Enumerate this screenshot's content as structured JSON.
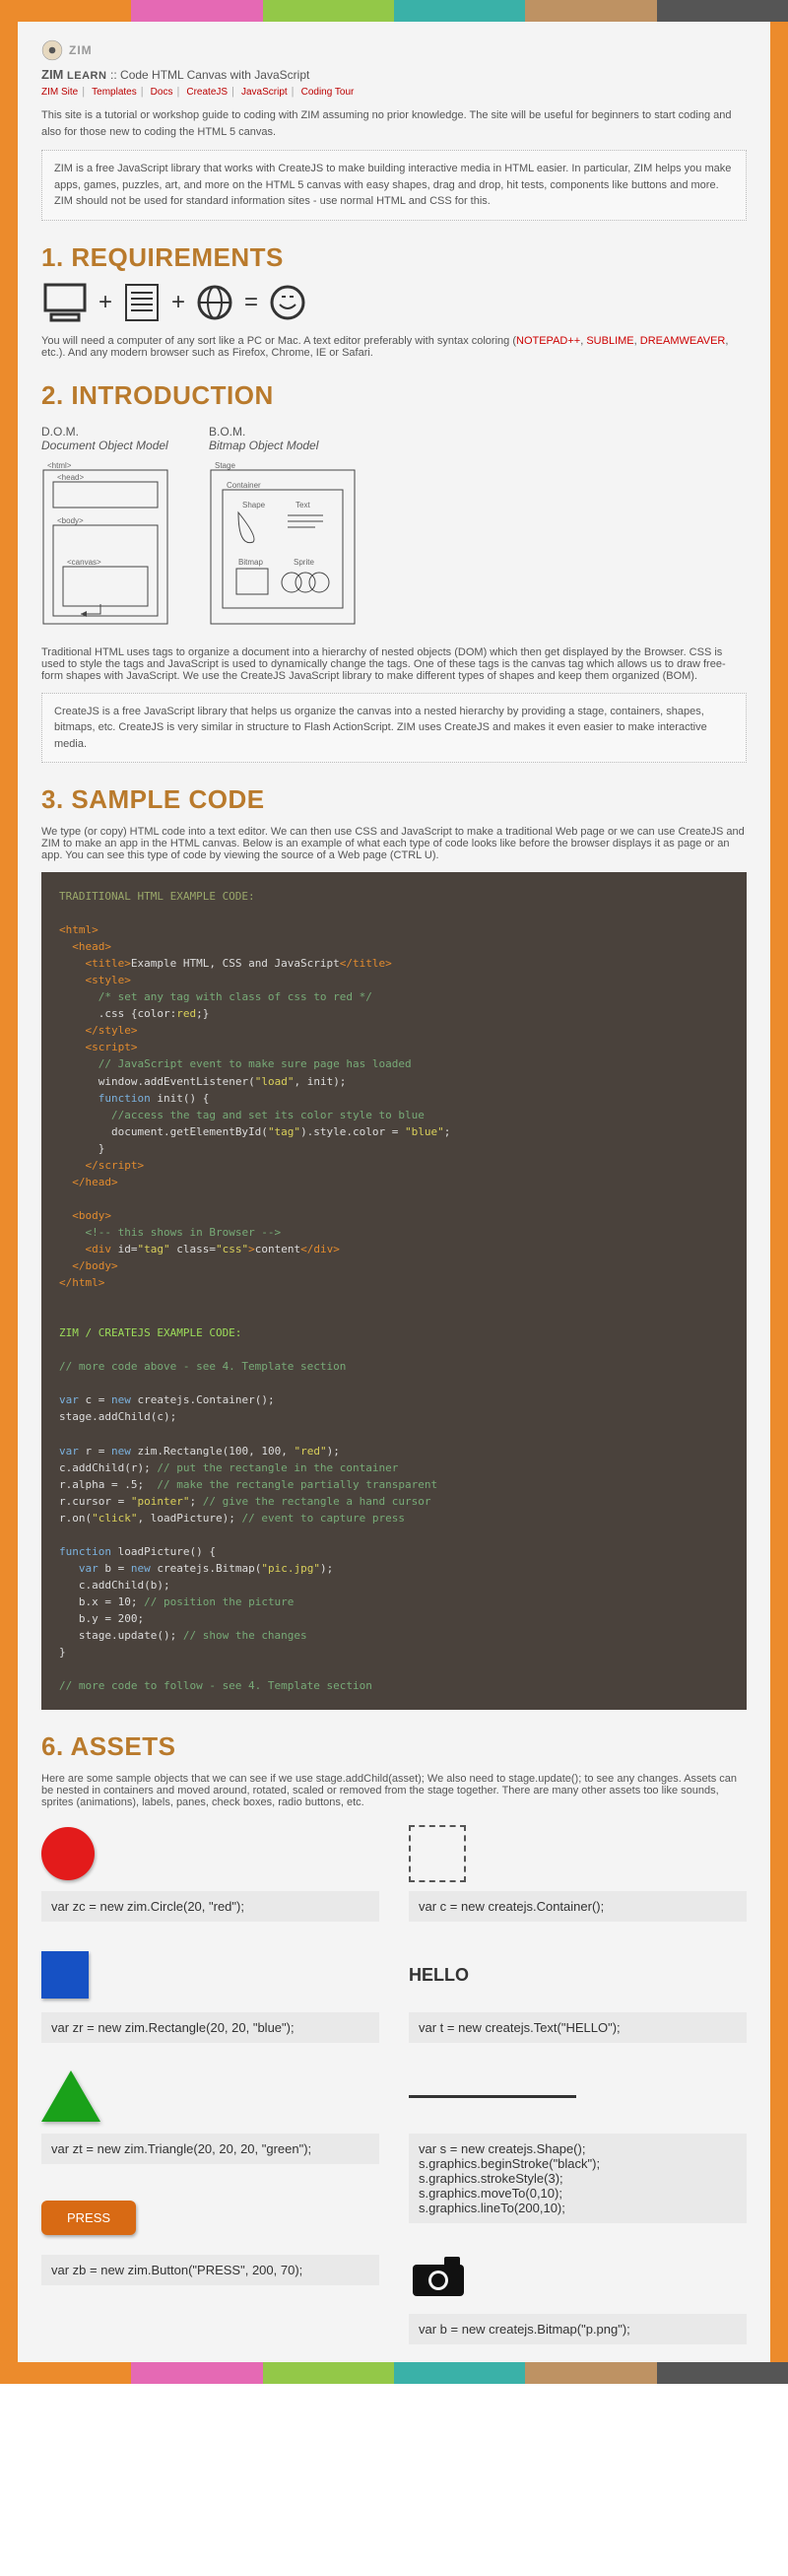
{
  "colors": {
    "s1": "#EC8B2C",
    "s2": "#E569B4",
    "s3": "#93C848",
    "s4": "#3AB1A8",
    "s5": "#BE9263",
    "s6": "#555555"
  },
  "logo_text": "ZIM",
  "title_main": "ZIM",
  "title_learn": "LEARN",
  "title_sub": ":: Code HTML Canvas with JavaScript",
  "nav": [
    "ZIM Site",
    "Templates",
    "Docs",
    "CreateJS",
    "JavaScript",
    "Coding Tour"
  ],
  "intro": "This site is a  tutorial  or workshop guide to coding with ZIM assuming no prior knowledge. The site will be useful for  beginners  to start coding and also for those new to coding the HTML 5 canvas.",
  "intro_callout": "ZIM is a free JavaScript library that works with CreateJS to make building interactive media in HTML easier. In particular, ZIM helps you make apps, games, puzzles, art, and more on the HTML 5 canvas with easy shapes, drag and drop, hit tests, components like buttons and more. ZIM should not be used for standard information sites - use normal HTML and CSS for this.",
  "s1_title": "1. REQUIREMENTS",
  "s1_text_a": "You will need a computer of any sort like a PC or Mac. A text editor preferably with syntax coloring (",
  "s1_link1": "NOTEPAD++",
  "s1_link2": "SUBLIME",
  "s1_link3": "DREAMWEAVER",
  "s1_text_b": ", etc.). And any modern browser such as Firefox, Chrome, IE or Safari.",
  "s2_title": "2. INTRODUCTION",
  "diag": {
    "dom_abbr": "D.O.M.",
    "dom_full": "Document Object Model",
    "dom_labels": [
      "<html>",
      "<head>",
      "<body>",
      "<canvas>"
    ],
    "bom_abbr": "B.O.M.",
    "bom_full": "Bitmap Object Model",
    "bom_labels": [
      "Stage",
      "Container",
      "Shape",
      "Text",
      "Bitmap",
      "Sprite"
    ]
  },
  "s2_text": "Traditional  HTML  uses tags to organize a document into a hierarchy of nested objects (DOM) which then get displayed by the Browser.  CSS  is used to style the tags and  JavaScript  is used to dynamically change the tags. One of these tags is the  canvas  tag which allows us to draw free-form shapes with JavaScript. We use the  CreateJS  JavaScript library to make different types of shapes and keep them organized (BOM).",
  "s2_callout": "CreateJS is a free JavaScript library that helps us organize the canvas into a nested hierarchy by providing a stage, containers, shapes, bitmaps, etc. CreateJS is very similar in structure to Flash ActionScript. ZIM uses CreateJS and makes it even easier to make interactive media.",
  "s3_title": "3. SAMPLE CODE",
  "s3_text": "We type (or copy) HTML code into a text editor. We can then use CSS and JavaScript to make a traditional Web page or we can use CreateJS and ZIM to make an app in the HTML canvas. Below is an example of what each type of code looks like before the browser displays it as page or an app. You can see this type of code by viewing the source of a Web page (CTRL U).",
  "code_trad_title": "TRADITIONAL HTML EXAMPLE CODE:",
  "code_zim_title": "ZIM / CREATEJS EXAMPLE CODE:",
  "s6_title": "6. ASSETS",
  "s6_text": "Here are some sample objects that we can see if we use  stage.addChild(asset);  We also need to  stage.update();  to see any changes. Assets can be nested in containers and moved around, rotated, scaled or removed from the stage together. There are many other assets too like sounds, sprites (animations), labels, panes, check boxes, radio buttons, etc.",
  "assets": {
    "circle": "var  zc = new zim.Circle(20,  \"red\");",
    "rect": "var  zr = new zim.Rectangle(20, 20,  \"blue\");",
    "tri": "var  zt = new zim.Triangle(20, 20, 20,  \"green\");",
    "btn_label": "PRESS",
    "btn": "var  zb = new zim.Button(\"PRESS\",  200,  70);",
    "container": "var  c = new createjs.Container();",
    "text_label": "HELLO",
    "text": "var  t = new createjs.Text(\"HELLO\");",
    "shape": "var  s = new createjs.Shape();\ns.graphics.beginStroke(\"black\");\ns.graphics.strokeStyle(3);\ns.graphics.moveTo(0,10);\ns.graphics.lineTo(200,10);",
    "bitmap": "var  b = new createjs.Bitmap(\"p.png\");"
  }
}
